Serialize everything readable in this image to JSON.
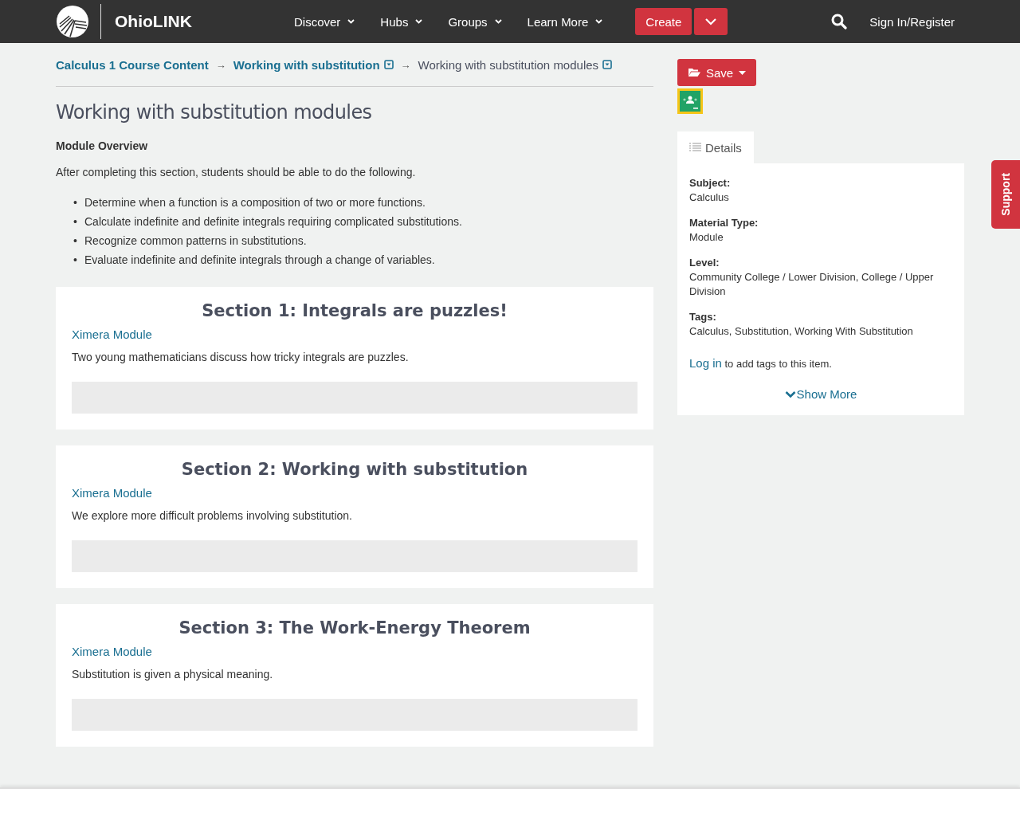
{
  "header": {
    "brand": "OhioLINK",
    "nav": [
      {
        "label": "Discover"
      },
      {
        "label": "Hubs"
      },
      {
        "label": "Groups"
      },
      {
        "label": "Learn More"
      }
    ],
    "create": "Create",
    "sign_in": "Sign In/Register"
  },
  "breadcrumbs": [
    {
      "label": "Calculus 1 Course Content",
      "link": true
    },
    {
      "label": "Working with substitution",
      "link": true
    },
    {
      "label": "Working with substitution modules",
      "link": false
    }
  ],
  "breadcrumb_separator": "→",
  "title": "Working with substitution modules",
  "overview_heading": "Module Overview",
  "intro": "After completing this section, students should be able to do the following.",
  "bullet": "•",
  "objectives": [
    "Determine when a function is a composition of two or more functions.",
    "Calculate indefinite and definite integrals requiring complicated substitutions.",
    "Recognize common patterns in substitutions.",
    "Evaluate indefinite and definite integrals through a change of variables."
  ],
  "sections": [
    {
      "title": "Section 1: Integrals are puzzles!",
      "source": "Ximera Module",
      "description": "Two young mathematicians discuss how tricky integrals are puzzles."
    },
    {
      "title": "Section 2: Working with substitution",
      "source": "Ximera Module",
      "description": "We explore more difficult problems involving substitution."
    },
    {
      "title": "Section 3: The Work-Energy Theorem",
      "source": "Ximera Module",
      "description": "Substitution is given a physical meaning."
    }
  ],
  "sidebar": {
    "save": "Save",
    "tab": "Details",
    "fields": [
      {
        "label": "Subject:",
        "value": "Calculus"
      },
      {
        "label": "Material Type:",
        "value": "Module"
      },
      {
        "label": "Level:",
        "value": "Community College / Lower Division, College / Upper Division"
      },
      {
        "label": "Tags:",
        "value": "Calculus, Substitution, Working With Substitution"
      }
    ],
    "login_link": "Log in",
    "login_text": "to add tags to this item.",
    "show_more": "Show More"
  },
  "support": "Support"
}
